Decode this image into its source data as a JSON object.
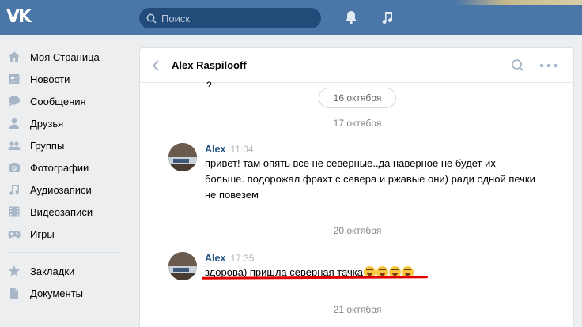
{
  "header": {
    "logo_text": "VK",
    "search_placeholder": "Поиск"
  },
  "sidebar": {
    "items": [
      {
        "label": "Моя Страница",
        "icon": "home-icon"
      },
      {
        "label": "Новости",
        "icon": "news-icon"
      },
      {
        "label": "Сообщения",
        "icon": "messages-icon"
      },
      {
        "label": "Друзья",
        "icon": "friends-icon"
      },
      {
        "label": "Группы",
        "icon": "groups-icon"
      },
      {
        "label": "Фотографии",
        "icon": "camera-icon"
      },
      {
        "label": "Аудиозаписи",
        "icon": "music-note-icon"
      },
      {
        "label": "Видеозаписи",
        "icon": "film-icon"
      },
      {
        "label": "Игры",
        "icon": "gamepad-icon"
      }
    ],
    "extra_items": [
      {
        "label": "Закладки",
        "icon": "star-icon"
      },
      {
        "label": "Документы",
        "icon": "document-icon"
      }
    ]
  },
  "chat": {
    "title": "Alex Raspilooff",
    "stray_char": "?",
    "date_pill": "16 октября",
    "dates": [
      "17 октября",
      "20 октября",
      "21 октября"
    ],
    "messages": [
      {
        "author": "Alex",
        "time": "11:04",
        "text": "привет! там опять все не северные..да наверное не будет их больше. подорожал фрахт с севера и ржавые они) ради одной печки не повезем"
      },
      {
        "author": "Alex",
        "time": "17:35",
        "text": "здорова) пришла северная тачка"
      }
    ]
  },
  "colors": {
    "header_bg": "#4a76a8",
    "link": "#2a5885",
    "highlight_underline": "#e00000"
  }
}
